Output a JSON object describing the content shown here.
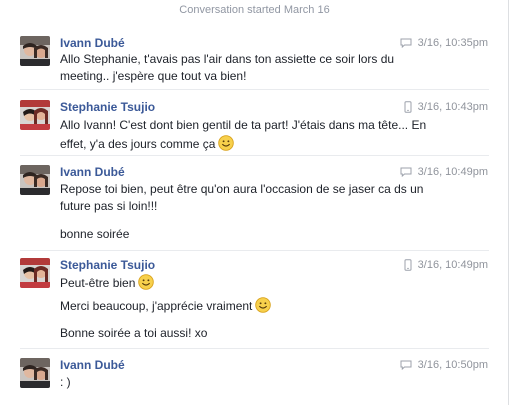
{
  "conversation_started": "Conversation started March 16",
  "messages": [
    {
      "sender": "Ivann Dubé",
      "device": "chat-icon",
      "time": "3/16, 10:35pm",
      "lines": [
        "Allo Stephanie, t'avais pas l'air dans ton assiette ce soir lors du",
        "meeting.. j'espère que tout va bien!"
      ]
    },
    {
      "sender": "Stephanie Tsujio",
      "device": "mobile-icon",
      "time": "3/16, 10:43pm",
      "lines": [
        "Allo Ivann! C'est dont bien gentil de ta part! J'étais dans ma tête... En",
        "effet, y'a des jours comme ça"
      ]
    },
    {
      "sender": "Ivann Dubé",
      "device": "chat-icon",
      "time": "3/16, 10:49pm",
      "lines": [
        "Repose toi bien, peut être qu'on aura l'occasion de se jaser ca ds un",
        "future pas si loin!!!",
        "bonne soirée"
      ]
    },
    {
      "sender": "Stephanie Tsujio",
      "device": "mobile-icon",
      "time": "3/16, 10:49pm",
      "lines": [
        "Peut-être bien",
        "Merci beaucoup, j'apprécie vraiment",
        "Bonne soirée a toi aussi! xo"
      ]
    },
    {
      "sender": "Ivann Dubé",
      "device": "chat-icon",
      "time": "3/16, 10:50pm",
      "lines": [
        ": )"
      ]
    }
  ]
}
